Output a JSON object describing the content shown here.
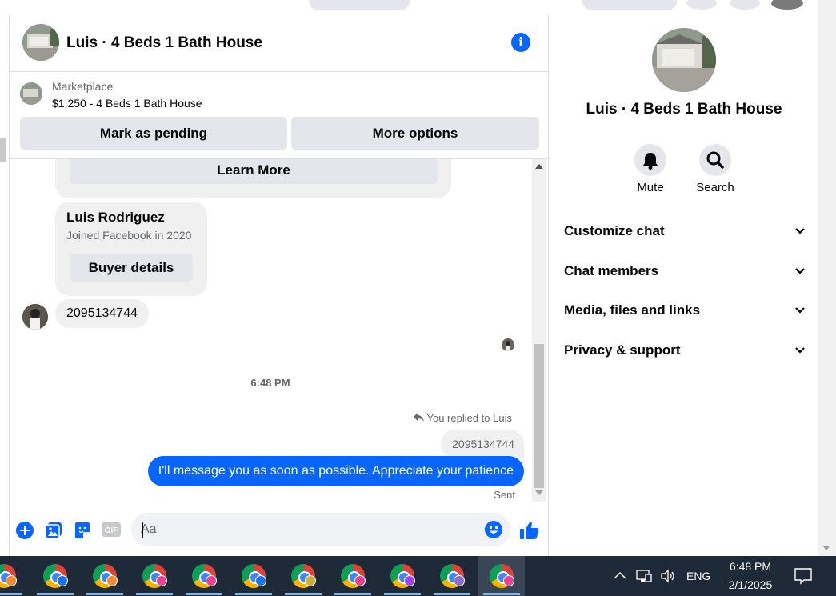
{
  "chat": {
    "title": "Luis · 4 Beds 1 Bath House",
    "marketplace_label": "Marketplace",
    "listing": "$1,250 - 4 Beds 1 Bath House",
    "mark_pending": "Mark as pending",
    "more_options": "More options"
  },
  "messages": {
    "learn_more": "Learn More",
    "buyer_name": "Luis Rodriguez",
    "buyer_joined": "Joined Facebook in 2020",
    "buyer_details": "Buyer details",
    "incoming_phone": "2095134744",
    "timestamp": "6:48 PM",
    "replied_label": "You replied to Luis",
    "quoted_text": "2095134744",
    "sent_text": "I'll message you as soon as possible. Appreciate your patience",
    "sent_status": "Sent"
  },
  "composer": {
    "placeholder": "Aa",
    "gif_label": "GIF"
  },
  "details": {
    "title": "Luis · 4 Beds 1 Bath House",
    "mute_label": "Mute",
    "search_label": "Search",
    "sections": [
      "Customize chat",
      "Chat members",
      "Media, files and links",
      "Privacy & support"
    ]
  },
  "taskbar": {
    "language": "ENG",
    "time": "6:48 PM",
    "date": "2/1/2025",
    "profile_colors": [
      "#f28b30",
      "#1a73e8",
      "#f28b30",
      "#e84393",
      "#e84393",
      "#1a73e8",
      "#c9b03a",
      "#e84393",
      "#a142f4",
      "#8e6cc7",
      "#e84393"
    ]
  },
  "colors": {
    "accent": "#0866ff",
    "taskbar": "#1f2a38"
  }
}
